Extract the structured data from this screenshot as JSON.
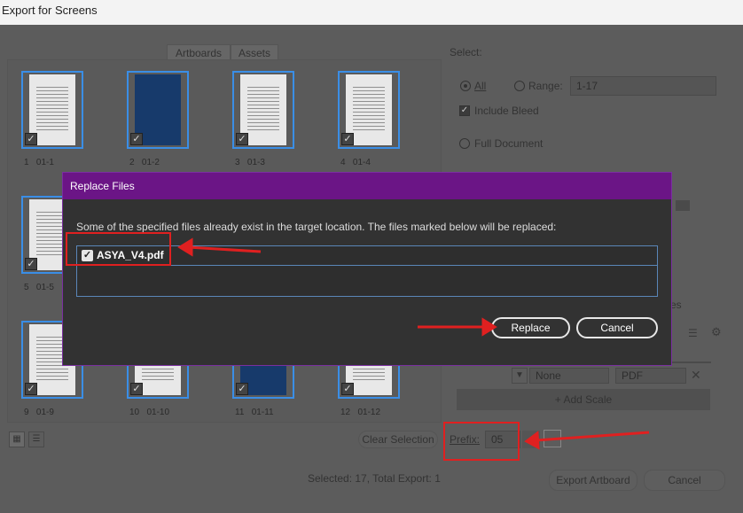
{
  "window": {
    "title": "Export for Screens"
  },
  "tabs": [
    "Artboards",
    "Assets"
  ],
  "artboards": [
    {
      "index": "1",
      "name": "01-1",
      "style": "light"
    },
    {
      "index": "2",
      "name": "01-2",
      "style": "blue"
    },
    {
      "index": "3",
      "name": "01-3",
      "style": "light"
    },
    {
      "index": "4",
      "name": "01-4",
      "style": "light"
    },
    {
      "index": "5",
      "name": "01-5",
      "style": "light"
    },
    {
      "index": "9",
      "name": "01-9",
      "style": "light"
    },
    {
      "index": "10",
      "name": "01-10",
      "style": "light"
    },
    {
      "index": "11",
      "name": "01-11",
      "style": "blue"
    },
    {
      "index": "12",
      "name": "01-12",
      "style": "light"
    }
  ],
  "select_panel": {
    "heading": "Select:",
    "all_label": "All",
    "range_label": "Range:",
    "range_value": "1-17",
    "include_bleed": "Include Bleed",
    "full_document": "Full Document"
  },
  "scale": {
    "suffix_value": "None",
    "format_value": "PDF",
    "add_scale": "+ Add Scale"
  },
  "prefix": {
    "label": "Prefix:",
    "value": "05"
  },
  "footer": {
    "clear_selection": "Clear Selection",
    "status": "Selected: 17, Total Export: 1",
    "export_button": "Export Artboard",
    "cancel_button": "Cancel"
  },
  "dialog": {
    "title": "Replace Files",
    "message": "Some of the specified files already exist in the target location. The files marked below will be replaced:",
    "files": [
      {
        "name": "ASYA_V4.pdf",
        "checked": "✓"
      }
    ],
    "replace_button": "Replace",
    "cancel_button": "Cancel"
  },
  "colors": {
    "dialog_title": "#6b1586",
    "annotation": "#e02020",
    "selection": "#3a8ee6"
  }
}
